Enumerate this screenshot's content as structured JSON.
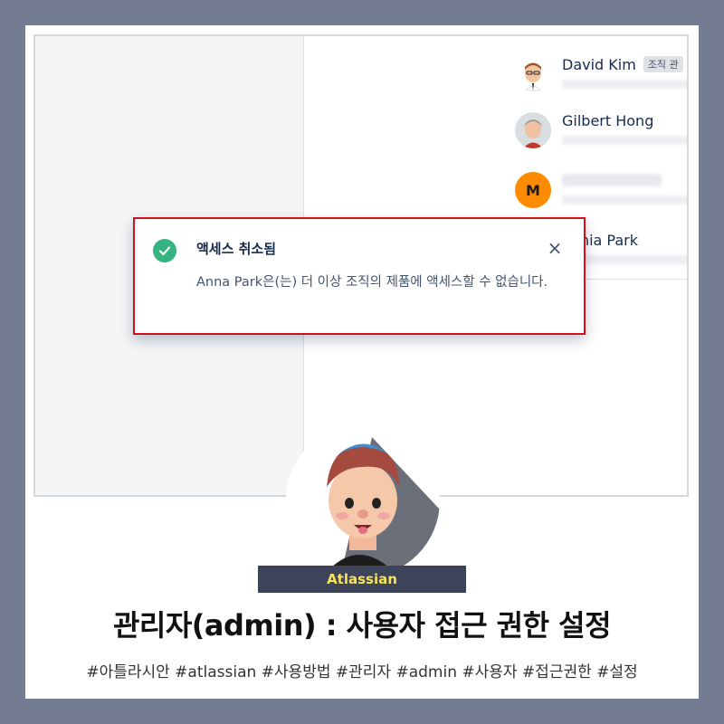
{
  "users": [
    {
      "name": "David Kim",
      "badge": "조직 관"
    },
    {
      "name": "Gilbert Hong"
    },
    {
      "initial": "M"
    },
    {
      "name": "ophia Park"
    }
  ],
  "toast": {
    "title": "액세스 취소됨",
    "message": "Anna Park은(는) 더 이상 조직의 제품에 액세스할 수 없습니다.",
    "close": "×",
    "status_color": "#36b37e",
    "highlight_color": "#d0111b"
  },
  "brand_label": "Atlassian",
  "headline": "관리자(admin) : 사용자 접근 권한 설정",
  "hashtags": "#아틀라시안 #atlassian #사용방법 #관리자 #admin #사용자 #접근권한 #설정"
}
